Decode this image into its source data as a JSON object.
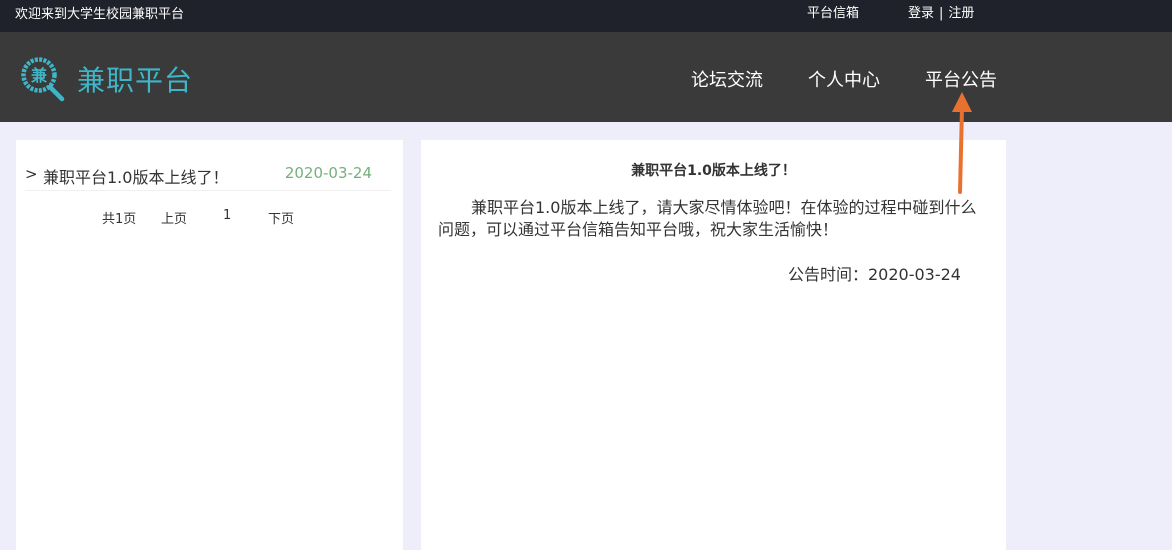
{
  "topbar": {
    "welcome": "欢迎来到大学生校园兼职平台",
    "mailbox": "平台信箱",
    "login": "登录",
    "separator": "|",
    "register": "注册"
  },
  "header": {
    "logo_char": "兼",
    "logo_text": "兼职平台",
    "nav": [
      "论坛交流",
      "个人中心",
      "平台公告"
    ]
  },
  "announcement_list": {
    "items": [
      {
        "caret": ">",
        "title": "兼职平台1.0版本上线了！",
        "date": "2020-03-24"
      }
    ],
    "pager": {
      "total": "共1页",
      "prev": "上页",
      "current": "1",
      "next": "下页"
    }
  },
  "announcement_detail": {
    "title": "兼职平台1.0版本上线了！",
    "body": "兼职平台1.0版本上线了，请大家尽情体验吧！在体验的过程中碰到什么问题，可以通过平台信箱告知平台哦，祝大家生活愉快！",
    "time": "公告时间：2020-03-24"
  },
  "colors": {
    "topbar_bg": "#20222b",
    "header_bg": "#3a3a3a",
    "brand": "#3fb6c7",
    "page_bg": "#eeeefb",
    "date_green": "#74b07a",
    "arrow": "#e8712f"
  }
}
